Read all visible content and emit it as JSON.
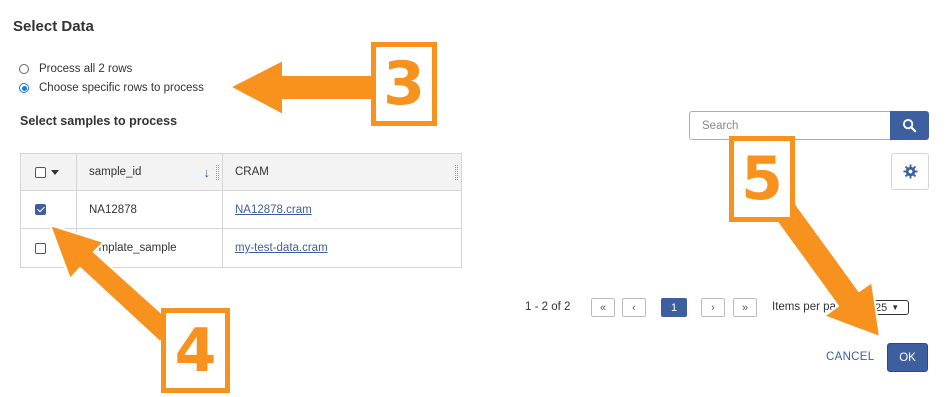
{
  "dialog": {
    "title": "Select Data"
  },
  "radio_options": [
    {
      "label": "Process all 2 rows",
      "checked": false
    },
    {
      "label": "Choose specific rows to process",
      "checked": true
    }
  ],
  "samples_label": "Select samples to process",
  "grid": {
    "columns": [
      "sample_id",
      "CRAM"
    ],
    "rows": [
      {
        "checked": true,
        "sample_id": "NA12878",
        "cram": "NA12878.cram"
      },
      {
        "checked": false,
        "sample_id": "template_sample",
        "cram": "my-test-data.cram"
      }
    ]
  },
  "search": {
    "placeholder": "Search"
  },
  "pagination": {
    "range_text": "1 - 2 of 2",
    "first": "«",
    "prev": "‹",
    "current_page": "1",
    "next": "›",
    "last": "»",
    "items_per_page_label": "Items per page",
    "page_size": "25"
  },
  "actions": {
    "cancel": "CANCEL",
    "ok": "OK"
  },
  "annotations": {
    "step3": "3",
    "step4": "4",
    "step5": "5"
  },
  "colors": {
    "accent": "#3d5f9f",
    "annotation": "#f7921e"
  }
}
